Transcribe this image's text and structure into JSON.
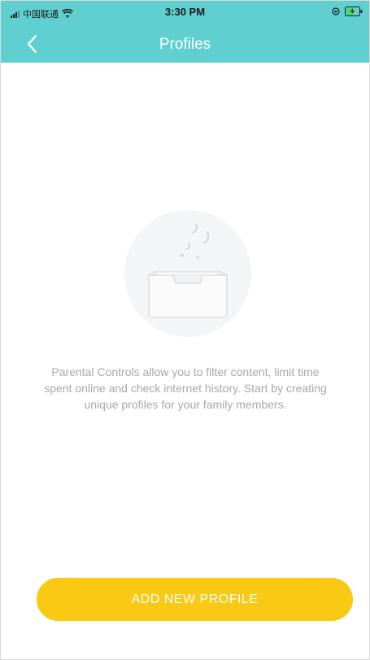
{
  "status_bar": {
    "carrier": "中国联通",
    "time": "3:30 PM"
  },
  "nav": {
    "title": "Profiles",
    "back_icon": "chevron-left-icon"
  },
  "empty_state": {
    "illustration": "empty-tray-icon",
    "message": "Parental Controls allow you to filter content, limit time spent online and check internet history. Start by creating unique profiles for your family members."
  },
  "actions": {
    "add_profile_label": "ADD NEW PROFILE"
  },
  "colors": {
    "header": "#5fcfd0",
    "primary_button": "#f9c914",
    "muted_text": "#a9a9a9"
  }
}
